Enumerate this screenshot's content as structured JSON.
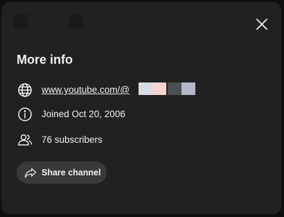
{
  "dialog": {
    "title": "More info",
    "close_icon": "close-icon",
    "rows": [
      {
        "icon": "globe-icon",
        "text": "www.youtube.com/@"
      },
      {
        "icon": "info-icon",
        "text": "Joined Oct 20, 2006"
      },
      {
        "icon": "subscribers-icon",
        "text": "76 subscribers"
      }
    ],
    "share": {
      "icon": "share-icon",
      "label": "Share channel"
    }
  },
  "colors": {
    "background": "#0f0f0f",
    "dialog": "#212121",
    "button": "#3a3a3a",
    "text": "#f1f1f1",
    "handle_blocks": [
      "#d6dde0",
      "#f7d3d0",
      "#4a4f53",
      "#b2b7c9"
    ]
  }
}
